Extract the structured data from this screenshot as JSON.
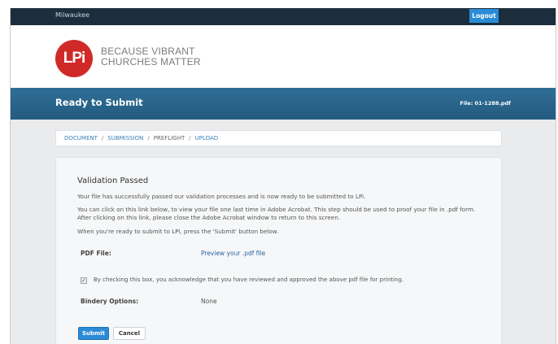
{
  "topbar": {
    "user": "Milwaukee",
    "logout_label": "Logout"
  },
  "brand": {
    "logo_mark": "LPi",
    "tagline_line1": "BECAUSE VIBRANT",
    "tagline_line2": "CHURCHES MATTER"
  },
  "banner": {
    "title": "Ready to Submit",
    "file_label": "File: 01-1288.pdf"
  },
  "breadcrumb": {
    "items": [
      "DOCUMENT",
      "SUBMISSION",
      "PREFLIGHT",
      "UPLOAD"
    ],
    "separator": "/"
  },
  "validation": {
    "heading": "Validation Passed",
    "para1": "Your file has successfully passed our validation processes and is now ready to be submitted to LPi.",
    "para2": "You can click on this link below, to view your file one last time in Adobe Acrobat. This step should be used to proof your file in .pdf form. After clicking on this link, please close the Adobe Acrobat window to return to this screen.",
    "para3": "When you're ready to submit to LPi, press the 'Submit' button below.",
    "pdf_label": "PDF File:",
    "pdf_link": "Preview your .pdf file",
    "checkbox_checked": true,
    "checkbox_mark": "✓",
    "acknowledge": "By checking this box, you acknowledge that you have reviewed and approved the above pdf file for printing.",
    "bindery_label": "Bindery Options:",
    "bindery_value": "None",
    "submit_label": "Submit",
    "cancel_label": "Cancel"
  },
  "colors": {
    "topbar": "#1c2e3d",
    "accent": "#2a8bd6",
    "banner": "#2a6488",
    "logo_red": "#d02a28",
    "link": "#3b7fb5"
  }
}
